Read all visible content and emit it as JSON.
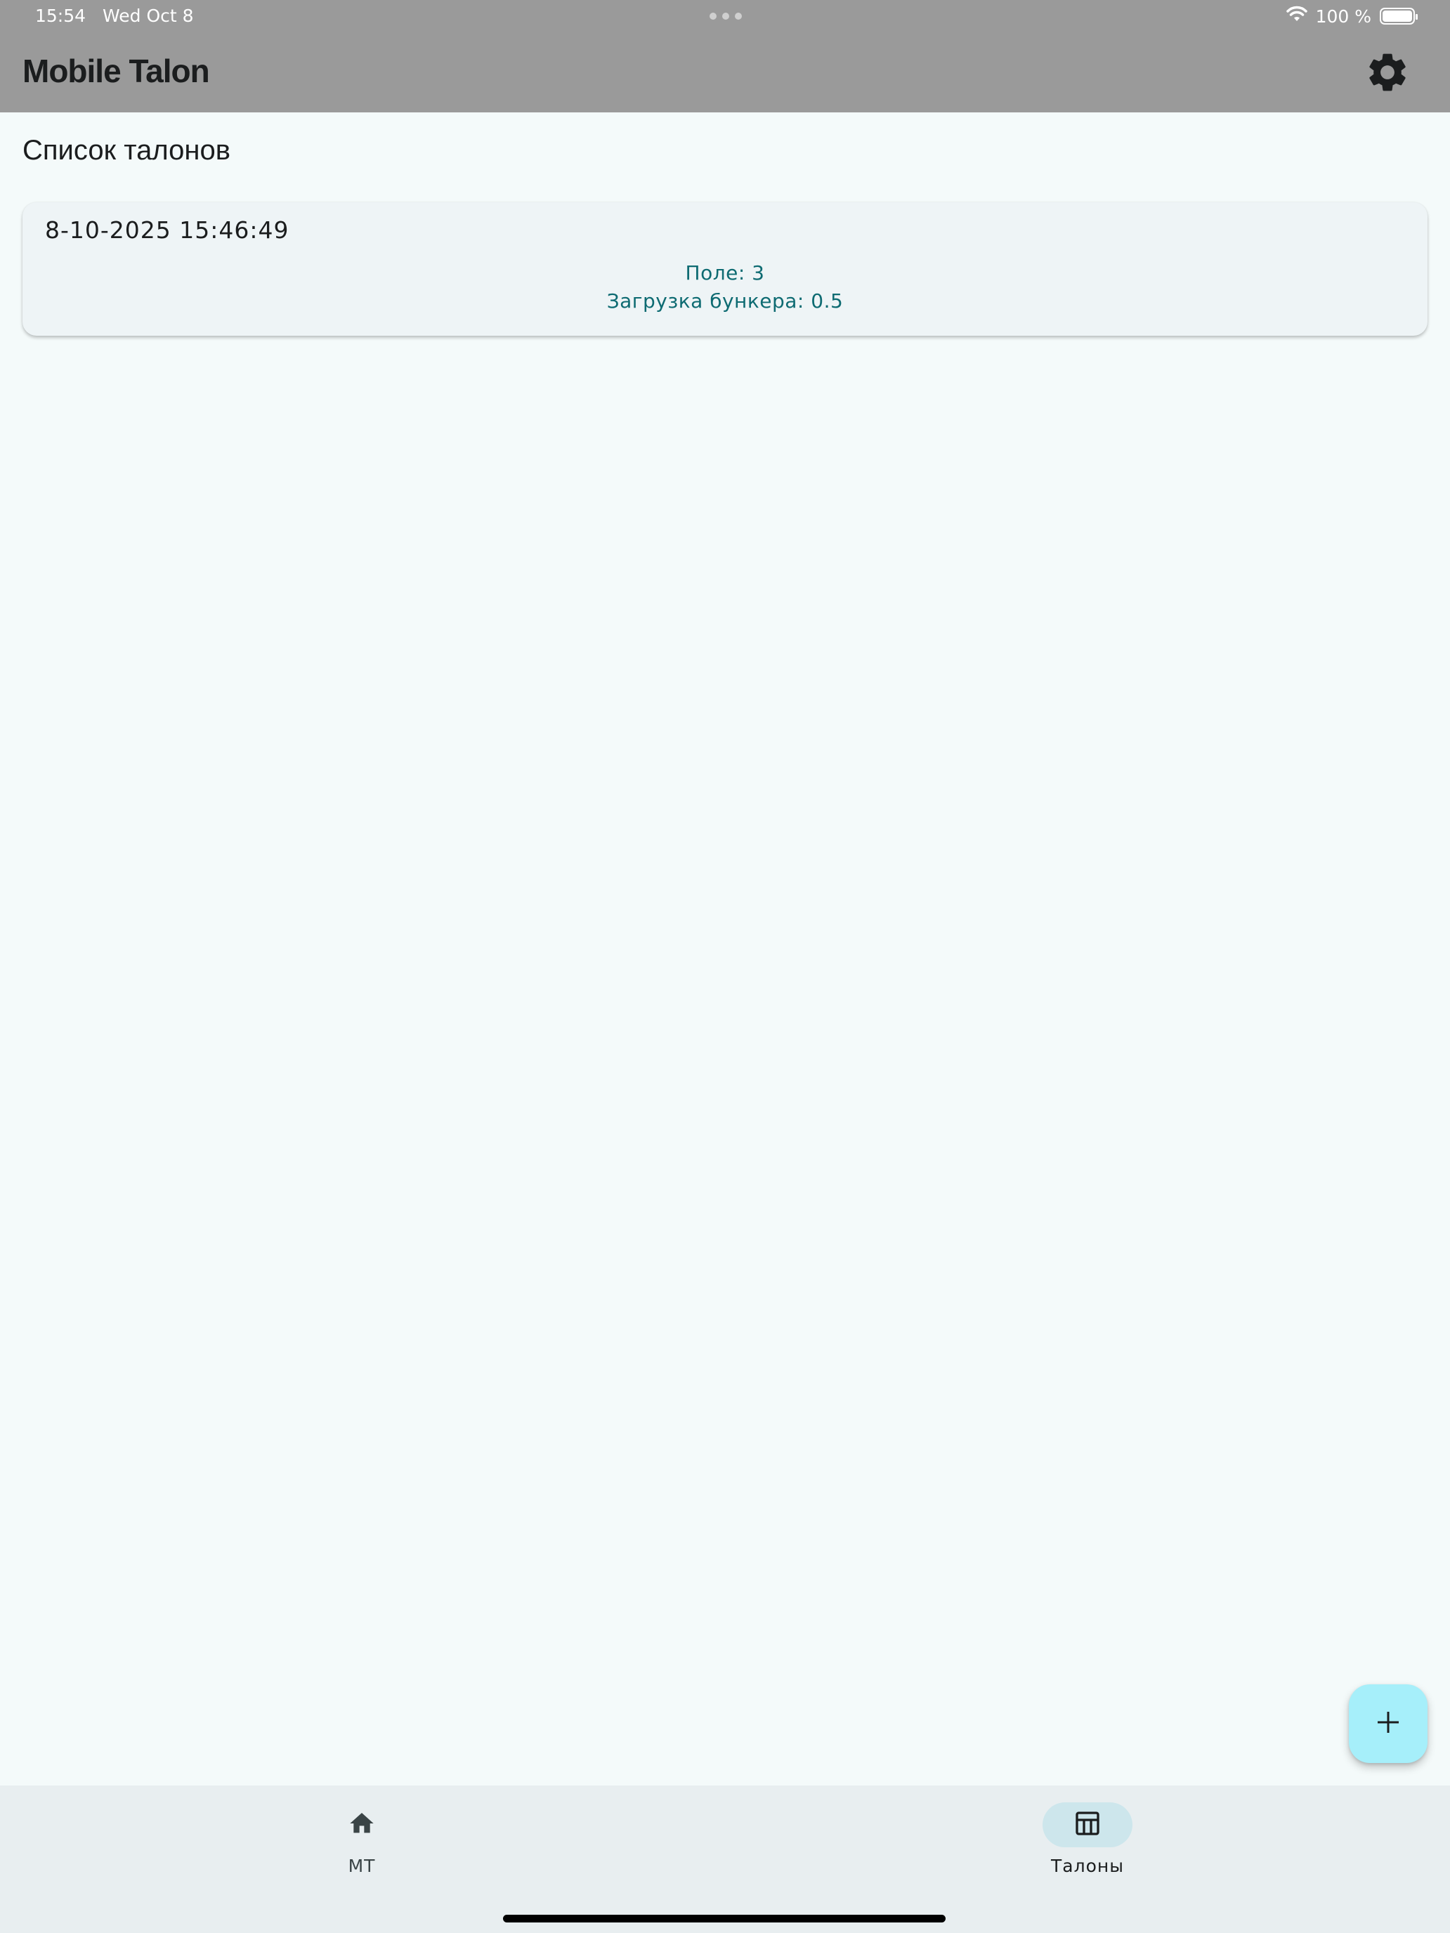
{
  "status_bar": {
    "time": "15:54",
    "date": "Wed Oct 8",
    "battery": "100 %"
  },
  "app_bar": {
    "title": "Mobile Talon"
  },
  "page": {
    "heading": "Список талонов"
  },
  "talons": [
    {
      "datetime": "8-10-2025 15:46:49",
      "field": "Поле: 3",
      "bunker_load": "Загрузка бункера: 0.5"
    }
  ],
  "bottom_nav": {
    "items": [
      {
        "label": "МТ",
        "icon": "home-icon",
        "selected": false
      },
      {
        "label": "Талоны",
        "icon": "table-icon",
        "selected": true
      }
    ]
  },
  "colors": {
    "top_bar": "#9a9a9a",
    "background": "#f4fafa",
    "card_background": "#eef4f6",
    "card_detail_text": "#0e6b72",
    "fab": "#a6effa",
    "bottom_nav": "#e8eef0",
    "nav_selected_pill": "#cde6ec"
  }
}
